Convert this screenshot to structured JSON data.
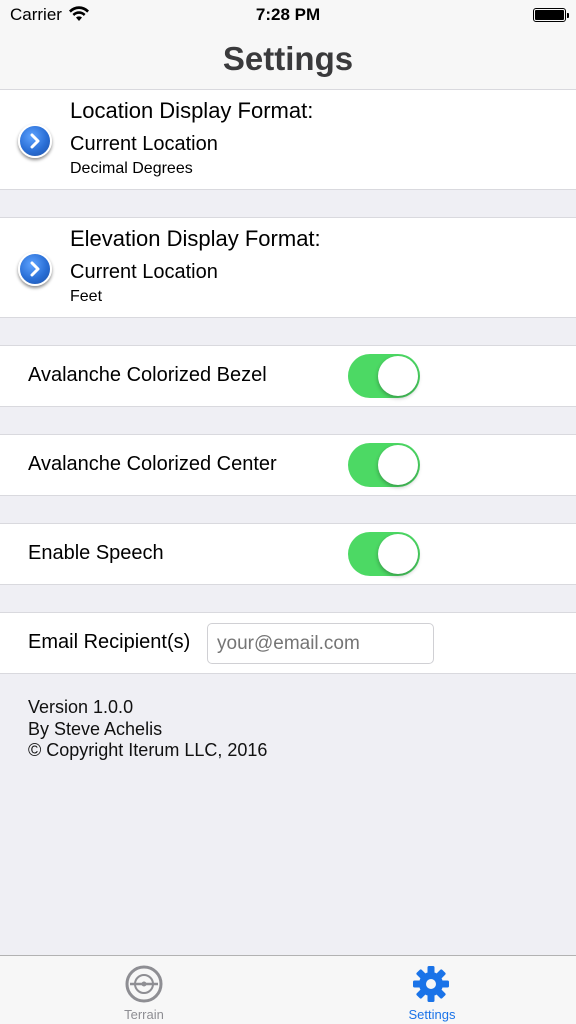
{
  "status_bar": {
    "carrier": "Carrier",
    "time": "7:28 PM"
  },
  "nav": {
    "title": "Settings"
  },
  "location_format": {
    "title": "Location Display Format:",
    "value": "Current Location",
    "detail": "Decimal Degrees"
  },
  "elevation_format": {
    "title": "Elevation Display Format:",
    "value": "Current Location",
    "detail": "Feet"
  },
  "toggles": [
    {
      "label": "Avalanche Colorized Bezel",
      "on": true
    },
    {
      "label": "Avalanche Colorized Center",
      "on": true
    },
    {
      "label": "Enable Speech",
      "on": true
    }
  ],
  "email": {
    "label": "Email Recipient(s)",
    "placeholder": "your@email.com"
  },
  "footer": {
    "version": "Version 1.0.0",
    "author": "By Steve Achelis",
    "copyright": "© Copyright Iterum LLC, 2016"
  },
  "tabs": [
    {
      "label": "Terrain",
      "icon": "terrain-icon",
      "active": false
    },
    {
      "label": "Settings",
      "icon": "gear-icon",
      "active": true
    }
  ],
  "colors": {
    "tint": "#1a73e8",
    "toggle_on": "#4cd964",
    "inactive": "#8e8e93"
  }
}
